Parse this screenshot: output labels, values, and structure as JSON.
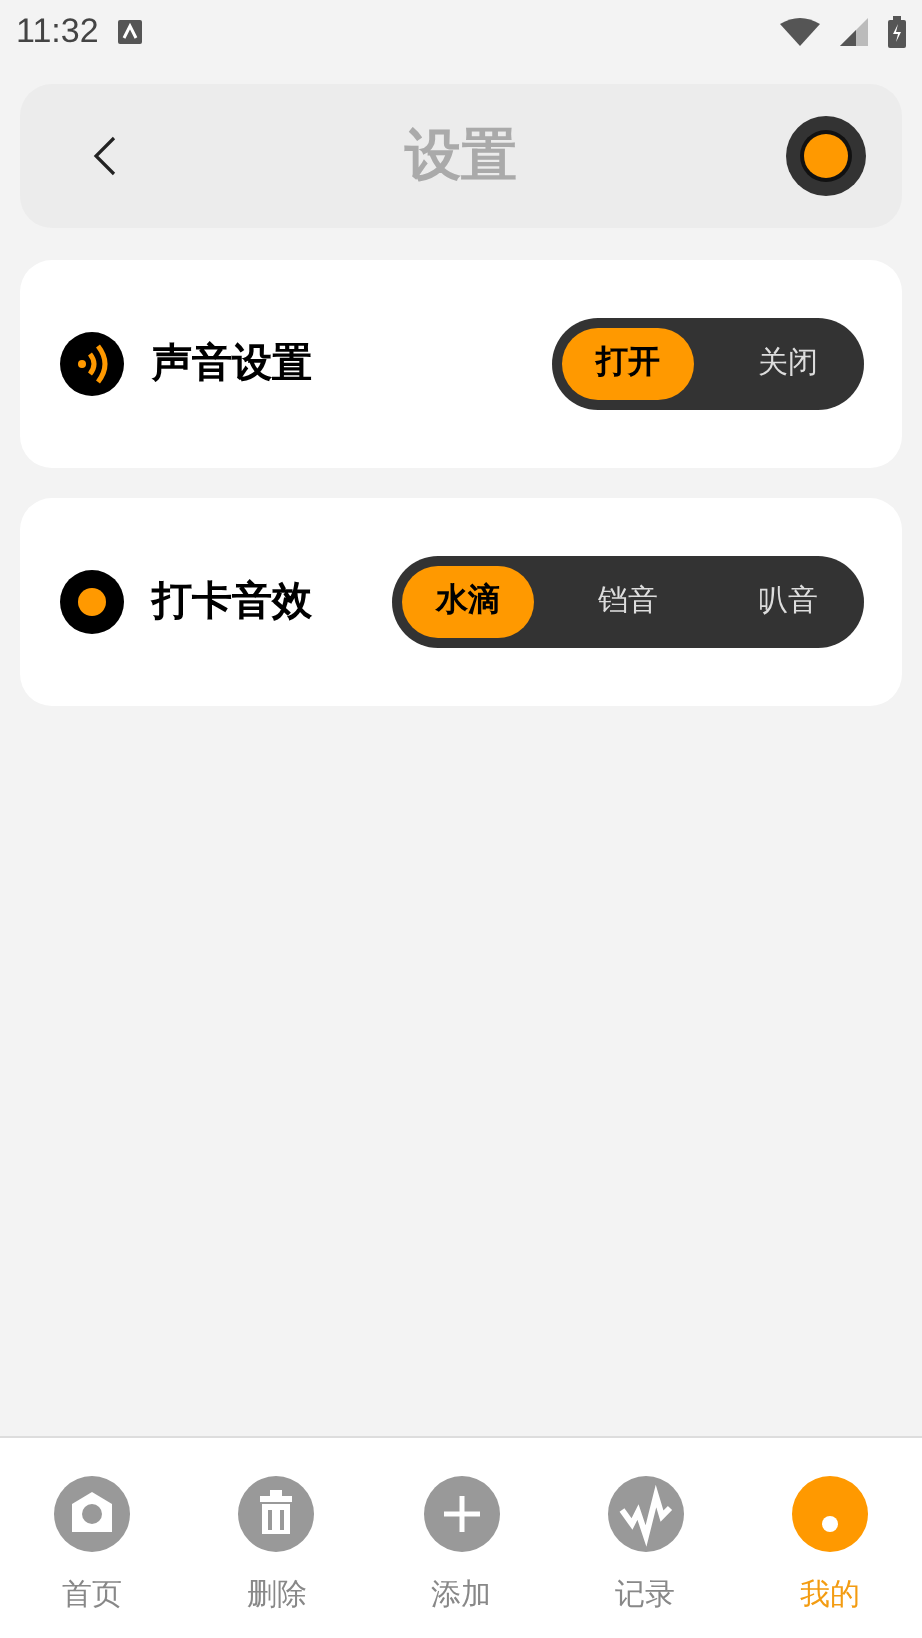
{
  "status_bar": {
    "time": "11:32"
  },
  "header": {
    "title": "设置"
  },
  "settings": [
    {
      "label": "声音设置",
      "options": [
        {
          "label": "打开",
          "selected": true
        },
        {
          "label": "关闭",
          "selected": false
        }
      ]
    },
    {
      "label": "打卡音效",
      "options": [
        {
          "label": "水滴",
          "selected": true
        },
        {
          "label": "铛音",
          "selected": false
        },
        {
          "label": "叭音",
          "selected": false
        }
      ]
    }
  ],
  "tab_bar": [
    {
      "label": "首页",
      "selected": false
    },
    {
      "label": "删除",
      "selected": false
    },
    {
      "label": "添加",
      "selected": false
    },
    {
      "label": "记录",
      "selected": false
    },
    {
      "label": "我的",
      "selected": true
    }
  ]
}
